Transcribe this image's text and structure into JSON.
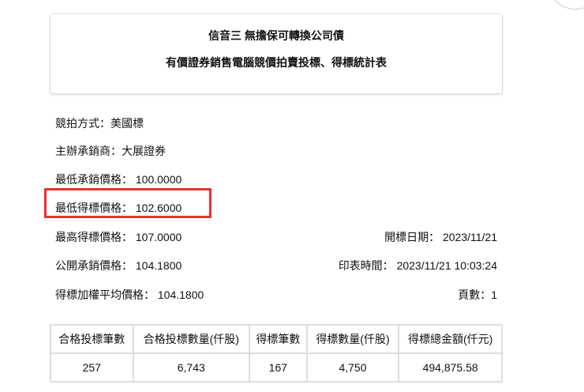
{
  "header": {
    "title": "信音三 無擔保可轉換公司債",
    "subtitle": "有價證券銷售電腦競價拍賣投標、得標統計表"
  },
  "info": {
    "auction_method": "競拍方式：美國標",
    "underwriter": "主辦承銷商：大展證券",
    "min_underwrite_price": "最低承銷價格： 100.0000",
    "min_winning_price": "最低得標價格： 102.6000",
    "max_winning_price": "最高得標價格： 107.0000",
    "public_price": "公開承銷價格： 104.1800",
    "weighted_avg_price": "得標加權平均價格： 104.1800",
    "open_date": "開標日期： 2023/11/21",
    "print_time": "印表時間： 2023/11/21 10:03:24",
    "page": "頁數：1"
  },
  "highlight_color": "#e8322f",
  "table": {
    "headers": [
      "合格投標筆數",
      "合格投標數量(仟股)",
      "得標筆數",
      "得標數量(仟股)",
      "得標總金額(仟元)"
    ],
    "rows": [
      [
        "257",
        "6,743",
        "167",
        "4,750",
        "494,875.58"
      ]
    ]
  }
}
